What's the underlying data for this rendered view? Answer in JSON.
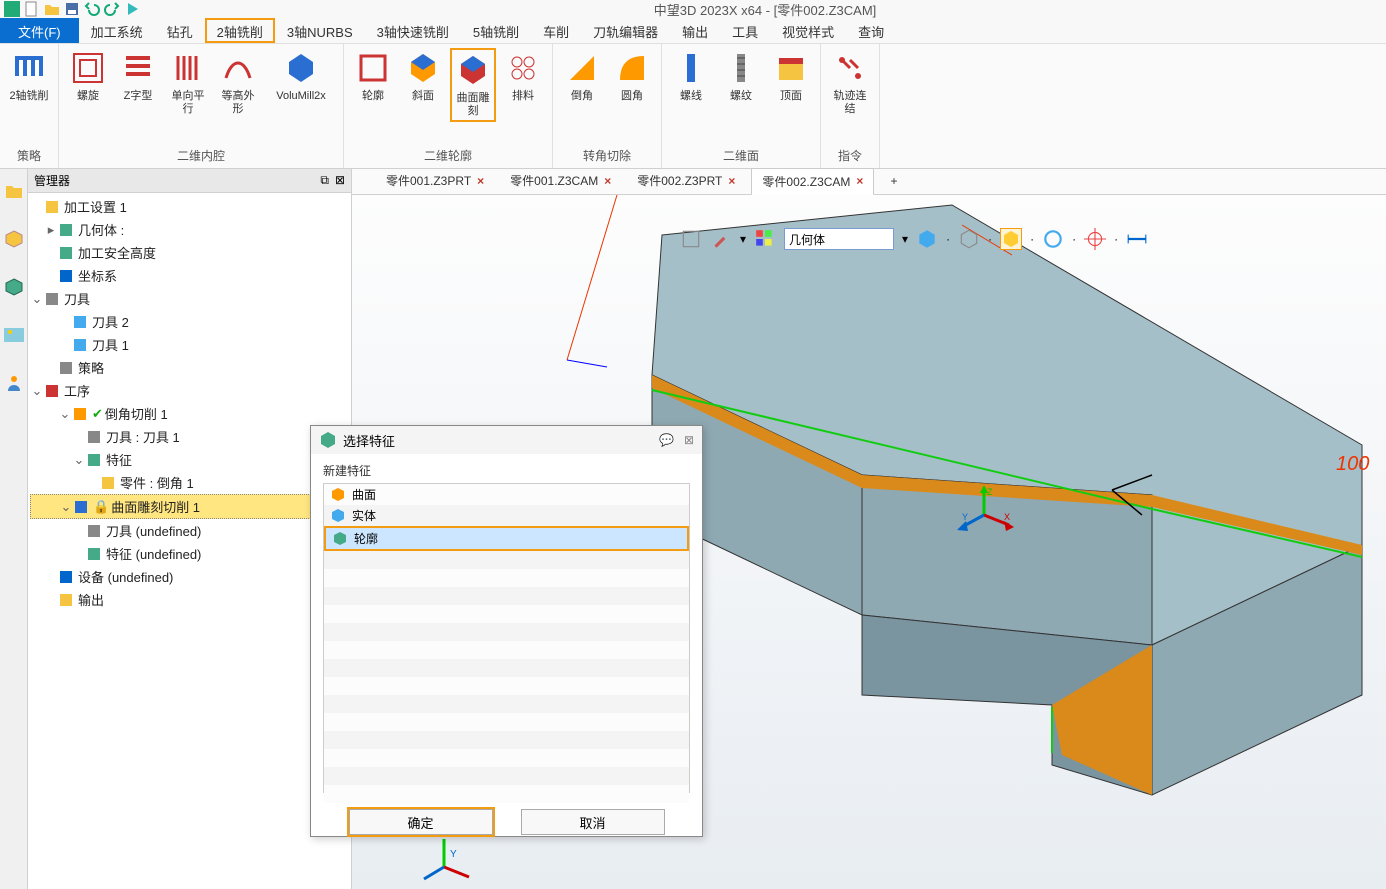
{
  "app": {
    "title": "中望3D 2023X x64 - [零件002.Z3CAM]"
  },
  "menubar": {
    "file": "文件(F)",
    "items": [
      "加工系统",
      "钻孔",
      "2轴铣削",
      "3轴NURBS",
      "3轴快速铣削",
      "5轴铣削",
      "车削",
      "刀轨编辑器",
      "输出",
      "工具",
      "视觉样式",
      "查询"
    ],
    "highlighted": "2轴铣削"
  },
  "ribbon": {
    "groups": [
      {
        "label": "策略",
        "buttons": [
          {
            "label": "2轴铣削",
            "icon": "mill2axis"
          }
        ]
      },
      {
        "label": "二维内腔",
        "buttons": [
          {
            "label": "螺旋",
            "icon": "spiral"
          },
          {
            "label": "Z字型",
            "icon": "zigzag"
          },
          {
            "label": "单向平行",
            "icon": "parallel"
          },
          {
            "label": "等高外形",
            "icon": "contour-h"
          },
          {
            "label": "VoluMill2x",
            "icon": "volumill",
            "wide": true
          }
        ]
      },
      {
        "label": "二维轮廓",
        "buttons": [
          {
            "label": "轮廓",
            "icon": "profile"
          },
          {
            "label": "斜面",
            "icon": "slope"
          },
          {
            "label": "曲面雕刻",
            "icon": "engrave",
            "highlight": true
          },
          {
            "label": "排料",
            "icon": "nest"
          }
        ]
      },
      {
        "label": "转角切除",
        "buttons": [
          {
            "label": "倒角",
            "icon": "chamfer"
          },
          {
            "label": "圆角",
            "icon": "fillet"
          }
        ]
      },
      {
        "label": "二维面",
        "buttons": [
          {
            "label": "螺线",
            "icon": "helix"
          },
          {
            "label": "螺纹",
            "icon": "thread"
          },
          {
            "label": "顶面",
            "icon": "topface"
          }
        ]
      },
      {
        "label": "指令",
        "buttons": [
          {
            "label": "轨迹连结",
            "icon": "link"
          }
        ]
      }
    ]
  },
  "manager": {
    "title": "管理器",
    "tree": [
      {
        "label": "加工设置 1",
        "icon": "folder",
        "indent": 0,
        "expand": ""
      },
      {
        "label": "几何体 :",
        "icon": "geo",
        "indent": 1,
        "expand": "▸"
      },
      {
        "label": "加工安全高度",
        "icon": "safeheight",
        "indent": 1,
        "expand": ""
      },
      {
        "label": "坐标系",
        "icon": "csys",
        "indent": 1,
        "expand": ""
      },
      {
        "label": "刀具",
        "icon": "tools",
        "indent": 0,
        "expand": "⌄"
      },
      {
        "label": "刀具 2",
        "icon": "tool",
        "indent": 2,
        "expand": ""
      },
      {
        "label": "刀具 1",
        "icon": "tool",
        "indent": 2,
        "expand": ""
      },
      {
        "label": "策略",
        "icon": "strategy",
        "indent": 1,
        "expand": ""
      },
      {
        "label": "工序",
        "icon": "ops",
        "indent": 0,
        "expand": "⌄"
      },
      {
        "label": "倒角切削 1",
        "icon": "op-chamfer",
        "indent": 2,
        "expand": "⌄",
        "check": true
      },
      {
        "label": "刀具 : 刀具 1",
        "icon": "dash",
        "indent": 3,
        "expand": ""
      },
      {
        "label": "特征",
        "icon": "feature",
        "indent": 3,
        "expand": "⌄"
      },
      {
        "label": "零件 : 倒角 1",
        "icon": "part",
        "indent": 4,
        "expand": ""
      },
      {
        "label": "曲面雕刻切削 1",
        "icon": "op-engrave",
        "indent": 2,
        "expand": "⌄",
        "selected": true,
        "lock": true
      },
      {
        "label": "刀具 (undefined)",
        "icon": "dash",
        "indent": 3,
        "expand": ""
      },
      {
        "label": "特征 (undefined)",
        "icon": "feature",
        "indent": 3,
        "expand": ""
      },
      {
        "label": "设备 (undefined)",
        "icon": "machine",
        "indent": 1,
        "expand": ""
      },
      {
        "label": "输出",
        "icon": "output",
        "indent": 1,
        "expand": ""
      }
    ]
  },
  "doctabs": [
    {
      "label": "零件001.Z3PRT",
      "active": false
    },
    {
      "label": "零件001.Z3CAM",
      "active": false
    },
    {
      "label": "零件002.Z3PRT",
      "active": false
    },
    {
      "label": "零件002.Z3CAM",
      "active": true
    }
  ],
  "viewtoolbar": {
    "selector": "几何体"
  },
  "dialog": {
    "title": "选择特征",
    "section": "新建特征",
    "items": [
      {
        "label": "曲面",
        "icon": "surface"
      },
      {
        "label": "实体",
        "icon": "solid"
      },
      {
        "label": "轮廓",
        "icon": "contour",
        "selected": true,
        "highlight": true
      }
    ],
    "ok": "确定",
    "cancel": "取消"
  },
  "annotations": {
    "dim100": "100"
  }
}
